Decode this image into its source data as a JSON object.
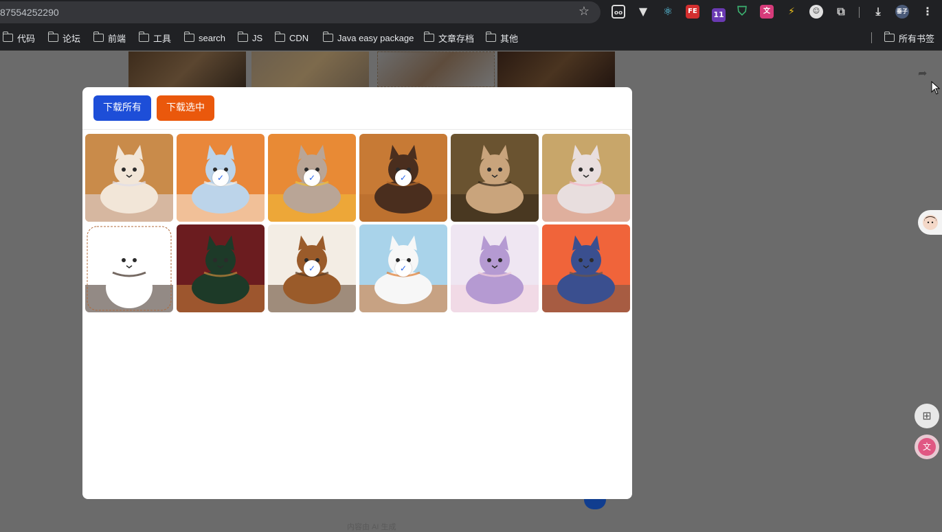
{
  "browser": {
    "url": "87554252290",
    "bookmarks": [
      "代码",
      "论坛",
      "前端",
      "工具",
      "search",
      "JS",
      "CDN",
      "Java easy package",
      "文章存档",
      "其他"
    ],
    "all_bookmarks": "所有书签",
    "profile_label": "垂子",
    "ext_badge": "11"
  },
  "modal": {
    "download_all": "下载所有",
    "download_selected": "下载选中",
    "checkmark": "✓",
    "images": [
      {
        "subject": "orange fluffy cat portrait",
        "selected": false,
        "colors": [
          "#c98b4a",
          "#f2e6d8",
          "#e0dde8"
        ]
      },
      {
        "subject": "orange cat watercolor clouds",
        "selected": true,
        "colors": [
          "#e9873a",
          "#bcd4ea",
          "#f7efe5"
        ]
      },
      {
        "subject": "cartoon orange cat with yarn",
        "selected": true,
        "colors": [
          "#e88a35",
          "#b9a596",
          "#f0c03a"
        ]
      },
      {
        "subject": "orange cat on wooden floor",
        "selected": true,
        "colors": [
          "#c77a35",
          "#4a2e1e",
          "#b46a2a"
        ]
      },
      {
        "subject": "tabby cat lying on floor",
        "selected": false,
        "colors": [
          "#6a5330",
          "#c9a47c",
          "#2d2216"
        ]
      },
      {
        "subject": "tabby cat under cherry blossom",
        "selected": false,
        "colors": [
          "#c8a66a",
          "#e8dede",
          "#f3b6c6"
        ]
      },
      {
        "subject": "cartoon tabby cat holding fish",
        "selected": false,
        "colors": [
          "#b86a3a",
          "#ffffff",
          "#3a2a20"
        ]
      },
      {
        "subject": "calico cat on red velvet sofa",
        "selected": false,
        "colors": [
          "#6b1c1f",
          "#1d3a28",
          "#c6873a"
        ]
      },
      {
        "subject": "calico cat sitting on wooden floor",
        "selected": true,
        "colors": [
          "#f3ede4",
          "#9a5b2a",
          "#5a3c24"
        ]
      },
      {
        "subject": "3d calico cat with yarn",
        "selected": true,
        "colors": [
          "#a9d3ea",
          "#f7f7f7",
          "#e07a2e"
        ]
      },
      {
        "subject": "calico cat on lavender pillow",
        "selected": false,
        "colors": [
          "#efe6f2",
          "#b59ad2",
          "#f2d0dc"
        ]
      },
      {
        "subject": "calico cat at sunset",
        "selected": false,
        "colors": [
          "#f0643a",
          "#3a4f8f",
          "#6b5648"
        ]
      }
    ]
  },
  "page": {
    "footer_hint": "内容由 AI 生成"
  }
}
